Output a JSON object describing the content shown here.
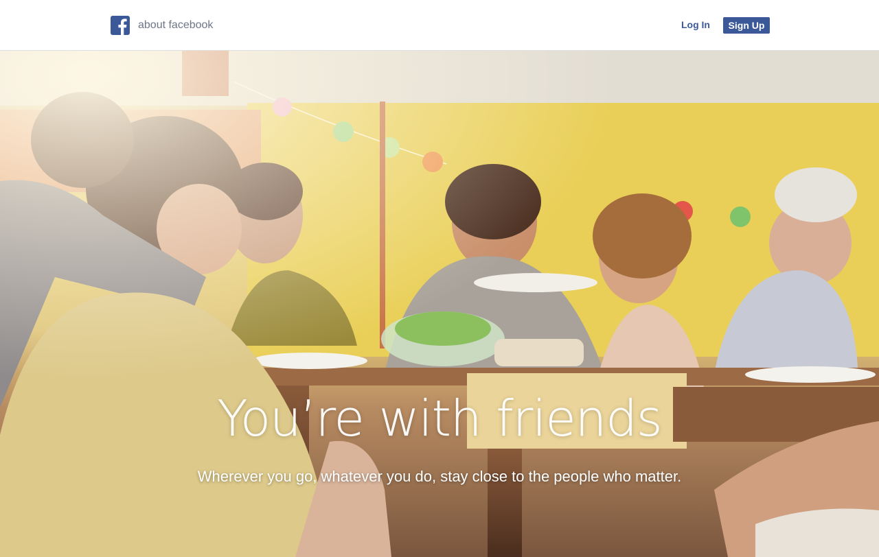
{
  "header": {
    "brand_label": "about facebook",
    "logo_icon": "facebook-f-icon",
    "login_label": "Log In",
    "signup_label": "Sign Up"
  },
  "hero": {
    "title": "You’re with friends",
    "subtitle": "Wherever you go, whatever you do, stay close to the people who matter.",
    "image_icon": "friends-dinner-photo"
  },
  "colors": {
    "brand_blue": "#3b5998",
    "brand_text_gray": "#6d7685",
    "header_bg": "#ffffff",
    "hero_text": "#ffffff"
  }
}
